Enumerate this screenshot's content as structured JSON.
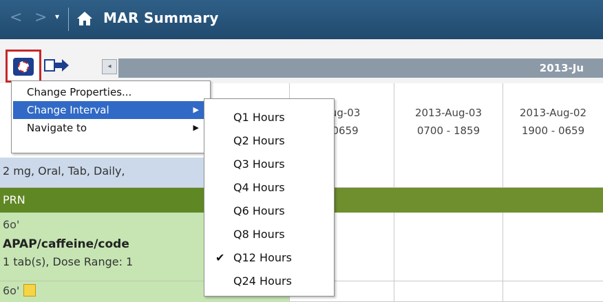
{
  "titlebar": {
    "title": "MAR Summary",
    "back_glyph": "<",
    "forward_glyph": ">",
    "dropdown_glyph": "▾"
  },
  "toolbar": {
    "prev_glyph": "◂",
    "date_band": "2013-Ju"
  },
  "columns": [
    {
      "line1": "Aug-03",
      "line2": "- 0659"
    },
    {
      "line1": "2013-Aug-03",
      "line2": "0700 - 1859"
    },
    {
      "line1": "2013-Aug-02",
      "line2": "1900 - 0659"
    }
  ],
  "rows": {
    "med_text": "2 mg, Oral, Tab, Daily,",
    "prn_label": "PRN",
    "apap_glasses": "6o'",
    "apap_name": "APAP/caffeine/code",
    "apap_dose": "1 tab(s), Dose Range: 1",
    "next_glasses": "6o'"
  },
  "context_menu": {
    "items": [
      {
        "label": "Change Properties...",
        "has_submenu": false
      },
      {
        "label": "Change Interval",
        "has_submenu": true,
        "highlighted": true
      },
      {
        "label": "Navigate to",
        "has_submenu": true
      }
    ],
    "submenu_glyph": "▶"
  },
  "interval_submenu": {
    "check_glyph": "✔",
    "items": [
      {
        "label": "Q1 Hours",
        "checked": false
      },
      {
        "label": "Q2 Hours",
        "checked": false
      },
      {
        "label": "Q3 Hours",
        "checked": false
      },
      {
        "label": "Q4 Hours",
        "checked": false
      },
      {
        "label": "Q6 Hours",
        "checked": false
      },
      {
        "label": "Q8 Hours",
        "checked": false
      },
      {
        "label": "Q12 Hours",
        "checked": true
      },
      {
        "label": "Q24 Hours",
        "checked": false
      }
    ]
  },
  "colors": {
    "titlebar": "#2a5478",
    "highlight": "#3169c6",
    "prn": "#6f8f2f",
    "med_row": "#ccd9ea",
    "apap_row": "#c6e5b3",
    "focus_border": "#c62828"
  }
}
